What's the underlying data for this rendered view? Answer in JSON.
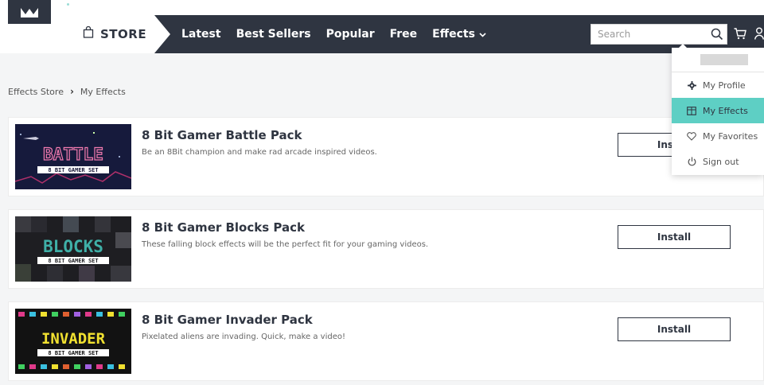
{
  "nav": {
    "store_label": "STORE",
    "links": [
      "Latest",
      "Best Sellers",
      "Popular",
      "Free",
      "Effects"
    ],
    "search_placeholder": "Search"
  },
  "breadcrumb": {
    "root": "Effects Store",
    "current": "My Effects"
  },
  "dropdown": {
    "items": [
      "My Profile",
      "My Effects",
      "My Favorites",
      "Sign out"
    ],
    "active_item": "My Effects"
  },
  "products": [
    {
      "title": "8 Bit Gamer Battle Pack",
      "description": "Be an 8Bit champion and make rad arcade inspired videos.",
      "install_label": "Install",
      "thumb_title": "BATTLE",
      "thumb_subtitle": "8 BIT GAMER SET"
    },
    {
      "title": "8 Bit Gamer Blocks Pack",
      "description": "These falling block effects will be the perfect fit for your gaming videos.",
      "install_label": "Install",
      "thumb_title": "BLOCKS",
      "thumb_subtitle": "8 BIT GAMER SET"
    },
    {
      "title": "8 Bit Gamer Invader Pack",
      "description": "Pixelated aliens are invading. Quick, make a video!",
      "install_label": "Install",
      "thumb_title": "INVADER",
      "thumb_subtitle": "8 BIT GAMER SET"
    }
  ],
  "colors": {
    "navbar": "#2f3541",
    "accent": "#5ecfc4",
    "page_bg": "#f4f5f6"
  }
}
